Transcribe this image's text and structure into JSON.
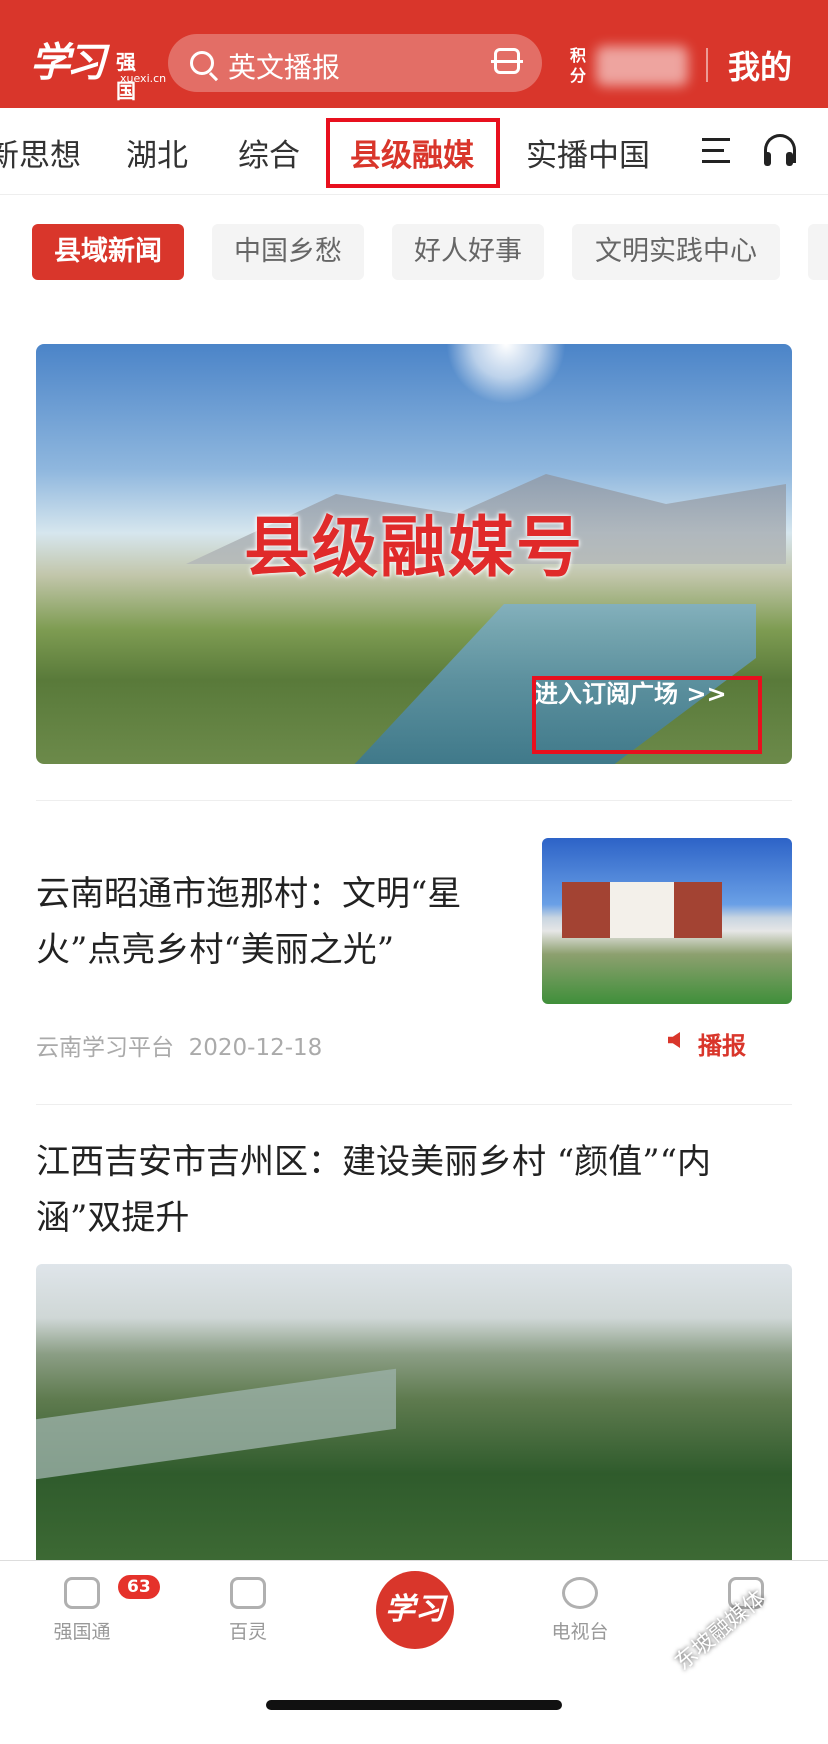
{
  "header": {
    "logo_main": "学习",
    "logo_sub": "强国",
    "logo_domain": "xuexi.cn",
    "search_text": "英文播报",
    "points_label": "积分",
    "mine_label": "我的"
  },
  "channels": {
    "items": [
      "新思想",
      "湖北",
      "综合",
      "县级融媒",
      "实播中国"
    ],
    "active": "县级融媒"
  },
  "subtabs": {
    "items": [
      "县域新闻",
      "中国乡愁",
      "好人好事",
      "文明实践中心"
    ],
    "active": "县域新闻"
  },
  "banner": {
    "title": "县级融媒号",
    "link": "进入订阅广场 >>"
  },
  "articles": [
    {
      "title": "云南昭通市迤那村：文明“星火”点亮乡村“美丽之光”",
      "source": "云南学习平台",
      "date": "2020-12-18",
      "action": "播报"
    },
    {
      "title": "江西吉安市吉州区：建设美丽乡村 “颜值”“内涵”双提升"
    }
  ],
  "tabbar": {
    "items": [
      {
        "label": "强国通",
        "badge": "63",
        "icon": "chat-icon"
      },
      {
        "label": "百灵",
        "icon": "video-icon"
      },
      {
        "label": "学习",
        "icon": "xuexi-logo"
      },
      {
        "label": "电视台",
        "icon": "play-icon"
      },
      {
        "label": "",
        "icon": "stats-icon"
      }
    ]
  },
  "watermark": "东坡融媒体",
  "colors": {
    "brand": "#d9362b",
    "highlight_box": "#e8101e"
  }
}
